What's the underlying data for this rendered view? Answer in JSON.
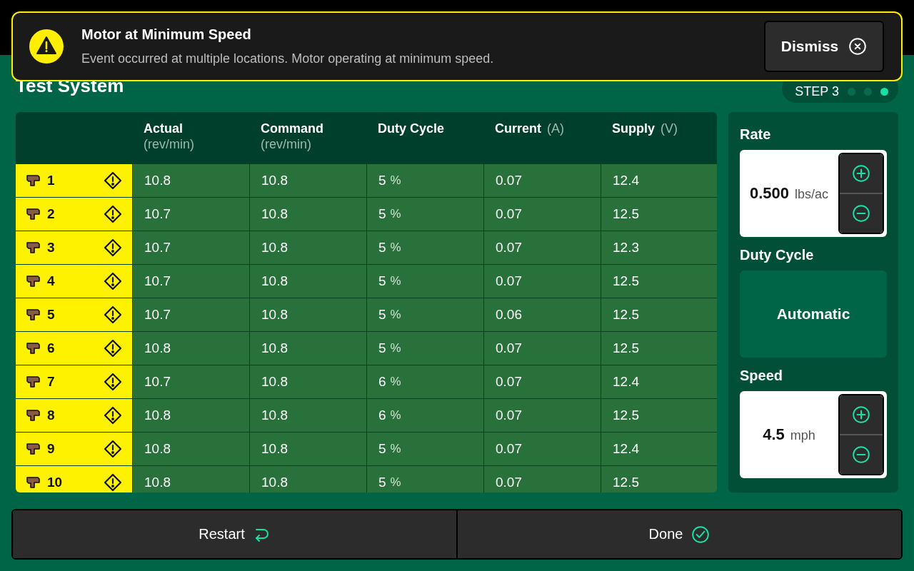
{
  "banner": {
    "title": "Motor at Minimum Speed",
    "message": "Event occurred at multiple locations. Motor operating at minimum speed.",
    "button": "Dismiss"
  },
  "page": {
    "title": "Test System"
  },
  "step": {
    "label": "STEP 3",
    "dots": [
      {
        "selected": false
      },
      {
        "selected": false
      },
      {
        "selected": true
      }
    ]
  },
  "table": {
    "columns": [
      {
        "kind": "stacked",
        "name": "Actual",
        "unit": "(rev/min)"
      },
      {
        "kind": "stacked",
        "name": "Command",
        "unit": "(rev/min)"
      },
      {
        "kind": "plain",
        "name": "Duty Cycle"
      },
      {
        "kind": "inline",
        "name": "Current",
        "unit": "(A)"
      },
      {
        "kind": "inline",
        "name": "Supply",
        "unit": "(V)"
      }
    ],
    "rows": [
      {
        "number": "1",
        "warning": true,
        "actual": "10.8",
        "command": "10.8",
        "duty": "5",
        "duty_unit": "%",
        "current": "0.07",
        "supply": "12.4"
      },
      {
        "number": "2",
        "warning": true,
        "actual": "10.7",
        "command": "10.8",
        "duty": "5",
        "duty_unit": "%",
        "current": "0.07",
        "supply": "12.5"
      },
      {
        "number": "3",
        "warning": true,
        "actual": "10.7",
        "command": "10.8",
        "duty": "5",
        "duty_unit": "%",
        "current": "0.07",
        "supply": "12.3"
      },
      {
        "number": "4",
        "warning": true,
        "actual": "10.7",
        "command": "10.8",
        "duty": "5",
        "duty_unit": "%",
        "current": "0.07",
        "supply": "12.5"
      },
      {
        "number": "5",
        "warning": true,
        "actual": "10.7",
        "command": "10.8",
        "duty": "5",
        "duty_unit": "%",
        "current": "0.06",
        "supply": "12.5"
      },
      {
        "number": "6",
        "warning": true,
        "actual": "10.8",
        "command": "10.8",
        "duty": "5",
        "duty_unit": "%",
        "current": "0.07",
        "supply": "12.5"
      },
      {
        "number": "7",
        "warning": true,
        "actual": "10.7",
        "command": "10.8",
        "duty": "6",
        "duty_unit": "%",
        "current": "0.07",
        "supply": "12.4"
      },
      {
        "number": "8",
        "warning": true,
        "actual": "10.8",
        "command": "10.8",
        "duty": "6",
        "duty_unit": "%",
        "current": "0.07",
        "supply": "12.5"
      },
      {
        "number": "9",
        "warning": true,
        "actual": "10.8",
        "command": "10.8",
        "duty": "5",
        "duty_unit": "%",
        "current": "0.07",
        "supply": "12.4"
      },
      {
        "number": "10",
        "warning": true,
        "actual": "10.8",
        "command": "10.8",
        "duty": "5",
        "duty_unit": "%",
        "current": "0.07",
        "supply": "12.5"
      }
    ]
  },
  "panel": [
    {
      "kind": "stepper",
      "label": "Rate",
      "value": "0.500",
      "unit": "lbs/ac"
    },
    {
      "kind": "mode",
      "label": "Duty Cycle",
      "value": "Automatic"
    },
    {
      "kind": "stepper",
      "label": "Speed",
      "value": "4.5",
      "unit": "mph"
    }
  ],
  "footer": [
    {
      "label": "Restart",
      "kind": "restart"
    },
    {
      "label": "Done",
      "kind": "done"
    }
  ]
}
